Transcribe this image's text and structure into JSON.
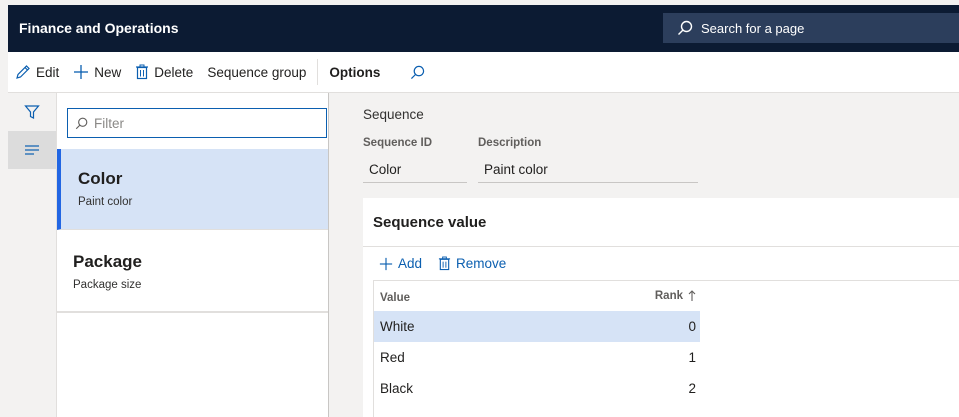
{
  "header": {
    "app_title": "Finance and Operations",
    "search_placeholder": "Search for a page"
  },
  "action_pane": {
    "edit": "Edit",
    "new": "New",
    "delete": "Delete",
    "sequence_group": "Sequence group",
    "options": "Options"
  },
  "list": {
    "filter_placeholder": "Filter",
    "items": [
      {
        "title": "Color",
        "subtitle": "Paint color",
        "selected": true
      },
      {
        "title": "Package",
        "subtitle": "Package size",
        "selected": false
      }
    ]
  },
  "details": {
    "section_label": "Sequence",
    "sequence_id_label": "Sequence ID",
    "sequence_id_value": "Color",
    "description_label": "Description",
    "description_value": "Paint color"
  },
  "sequence_value": {
    "title": "Sequence value",
    "add_label": "Add",
    "remove_label": "Remove",
    "col_value": "Value",
    "col_rank": "Rank",
    "rows": [
      {
        "value": "White",
        "rank": "0"
      },
      {
        "value": "Red",
        "rank": "1"
      },
      {
        "value": "Black",
        "rank": "2"
      }
    ]
  },
  "colors": {
    "nav_bar": "#0c1b33",
    "accent": "#2266e3",
    "link": "#0b5fb0",
    "selection": "#d6e3f6"
  },
  "icons": [
    "search-icon",
    "edit-icon",
    "add-icon",
    "delete-icon",
    "find-icon",
    "filter-icon",
    "list-icon"
  ]
}
